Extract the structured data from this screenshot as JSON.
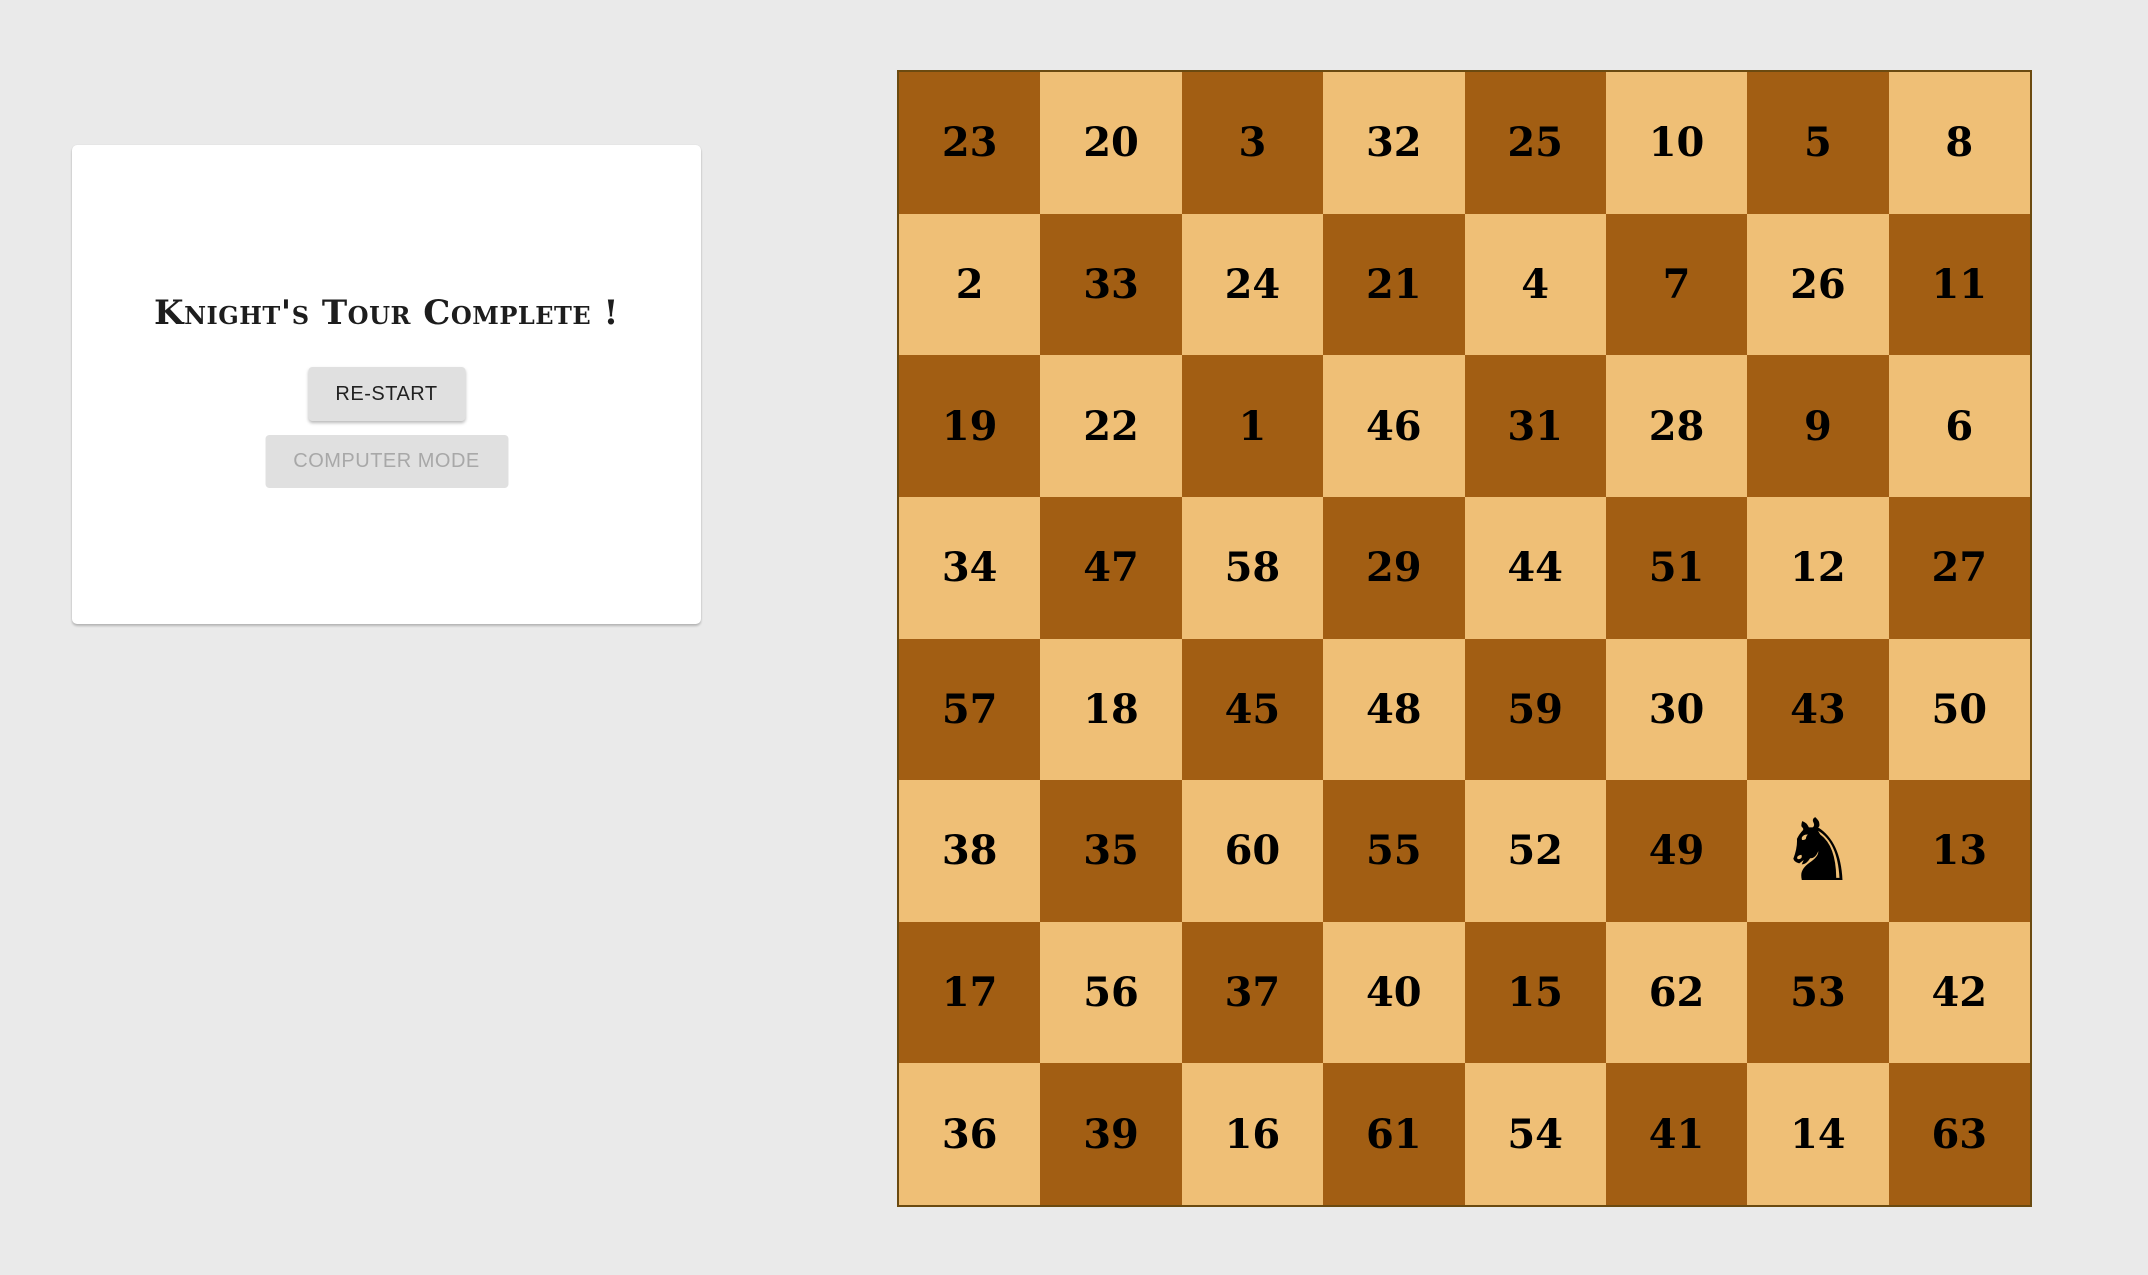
{
  "panel": {
    "status": "Knight's Tour Complete !",
    "restart_label": "RE-START",
    "computer_mode_label": "COMPUTER MODE"
  },
  "board": {
    "light_color": "#efbf76",
    "dark_color": "#a25e13",
    "rows": [
      [
        "23",
        "20",
        "3",
        "32",
        "25",
        "10",
        "5",
        "8"
      ],
      [
        "2",
        "33",
        "24",
        "21",
        "4",
        "7",
        "26",
        "11"
      ],
      [
        "19",
        "22",
        "1",
        "46",
        "31",
        "28",
        "9",
        "6"
      ],
      [
        "34",
        "47",
        "58",
        "29",
        "44",
        "51",
        "12",
        "27"
      ],
      [
        "57",
        "18",
        "45",
        "48",
        "59",
        "30",
        "43",
        "50"
      ],
      [
        "38",
        "35",
        "60",
        "55",
        "52",
        "49",
        "",
        "13"
      ],
      [
        "17",
        "56",
        "37",
        "40",
        "15",
        "62",
        "53",
        "42"
      ],
      [
        "36",
        "39",
        "16",
        "61",
        "54",
        "41",
        "14",
        "63"
      ]
    ],
    "knight_position": {
      "row": 6,
      "col": 7
    },
    "knight_icon": "knight-icon"
  }
}
